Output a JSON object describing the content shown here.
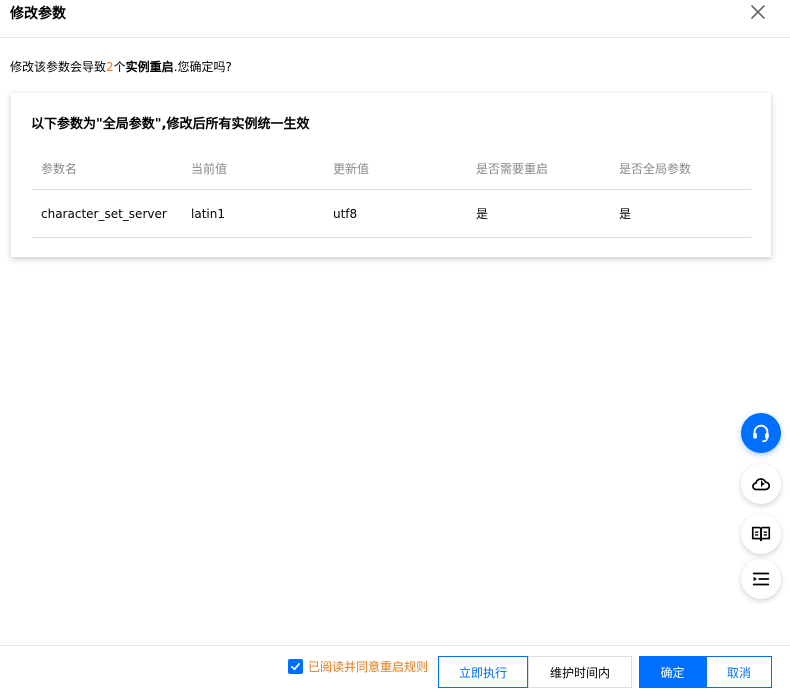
{
  "dialog": {
    "title": "修改参数"
  },
  "warning": {
    "prefix": "修改该参数会导致",
    "count": "2",
    "middle": "个",
    "strong": "实例重启",
    "suffix": ".您确定吗?"
  },
  "card": {
    "title": "以下参数为\"全局参数\",修改后所有实例统一生效",
    "columns": [
      "参数名",
      "当前值",
      "更新值",
      "是否需要重启",
      "是否全局参数"
    ],
    "rows": [
      [
        "character_set_server",
        "latin1",
        "utf8",
        "是",
        "是"
      ]
    ]
  },
  "float_buttons": [
    {
      "icon": "headset-icon"
    },
    {
      "icon": "cloud-icon"
    },
    {
      "icon": "book-icon"
    },
    {
      "icon": "outline-list-icon"
    }
  ],
  "footer": {
    "agree_label": "已阅读并同意重启规则",
    "agree_checked": true,
    "execute_now": "立即执行",
    "in_maintenance": "维护时间内",
    "confirm": "确定",
    "cancel": "取消"
  },
  "colors": {
    "primary": "#006eff",
    "warning_count": "#ff7200",
    "agree_label": "#e37a1a"
  }
}
